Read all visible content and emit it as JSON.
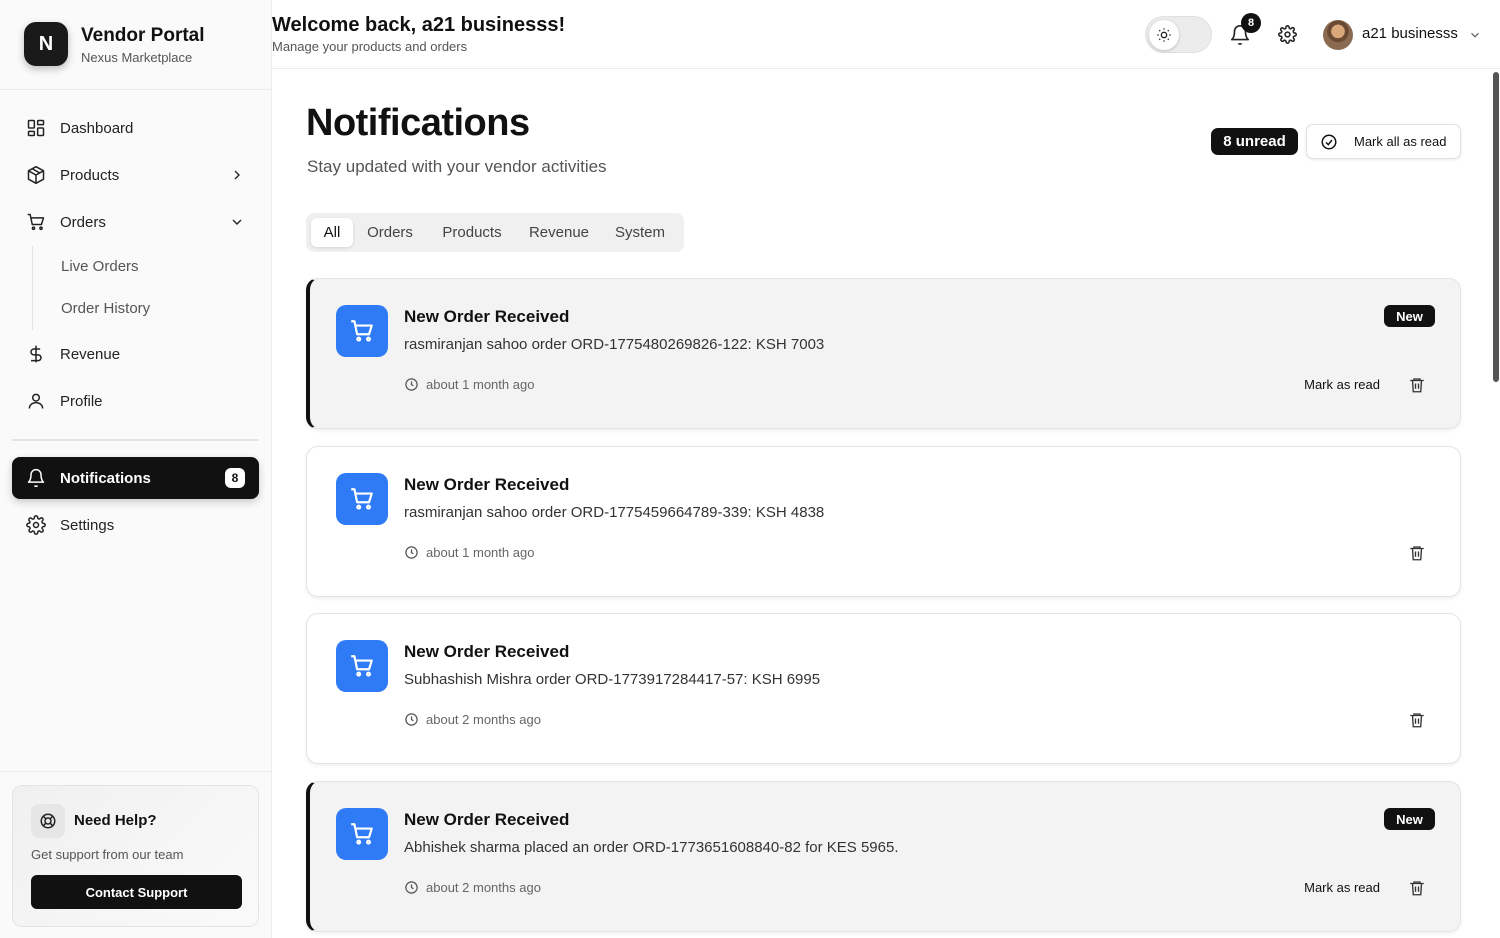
{
  "brand": {
    "logo_letter": "N",
    "title": "Vendor Portal",
    "subtitle": "Nexus Marketplace"
  },
  "sidebar": {
    "nav": [
      {
        "label": "Dashboard",
        "icon": "dashboard-icon"
      },
      {
        "label": "Products",
        "icon": "box-icon"
      },
      {
        "label": "Orders",
        "icon": "cart-icon"
      },
      {
        "label": "Revenue",
        "icon": "dollar-icon"
      },
      {
        "label": "Profile",
        "icon": "user-icon"
      }
    ],
    "orders_sub": [
      "Live Orders",
      "Order History"
    ],
    "notifications": {
      "label": "Notifications",
      "badge": "8"
    },
    "settings": {
      "label": "Settings"
    },
    "help": {
      "title": "Need Help?",
      "subtitle": "Get support from our team",
      "button": "Contact Support"
    }
  },
  "header": {
    "welcome": "Welcome back, a21 businesss!",
    "subtitle": "Manage your products and orders",
    "bell_count": "8",
    "user_name": "a21 businesss"
  },
  "main": {
    "title": "Notifications",
    "subtitle": "Stay updated with your vendor activities",
    "unread": "8 unread",
    "mark_all": "Mark all as read",
    "tabs": [
      "All",
      "Orders",
      "Products",
      "Revenue",
      "System"
    ],
    "active_tab": "All",
    "notifications": [
      {
        "title": "New Order Received",
        "message": "rasmiranjan sahoo order ORD-1775480269826-122: KSH 7003",
        "time": "about 1 month ago",
        "unread": true,
        "badge": "New",
        "mark_read": "Mark as read"
      },
      {
        "title": "New Order Received",
        "message": "rasmiranjan sahoo order ORD-1775459664789-339: KSH 4838",
        "time": "about 1 month ago",
        "unread": false
      },
      {
        "title": "New Order Received",
        "message": "Subhashish Mishra order ORD-1773917284417-57: KSH 6995",
        "time": "about 2 months ago",
        "unread": false
      },
      {
        "title": "New Order Received",
        "message": "Abhishek sharma placed an order ORD-1773651608840-82 for KES 5965.",
        "time": "about 2 months ago",
        "unread": true,
        "badge": "New",
        "mark_read": "Mark as read"
      }
    ]
  },
  "colors": {
    "accent": "#111111",
    "icon_blue": "#2f7bf5",
    "unread_bg": "#f3f3f3"
  }
}
